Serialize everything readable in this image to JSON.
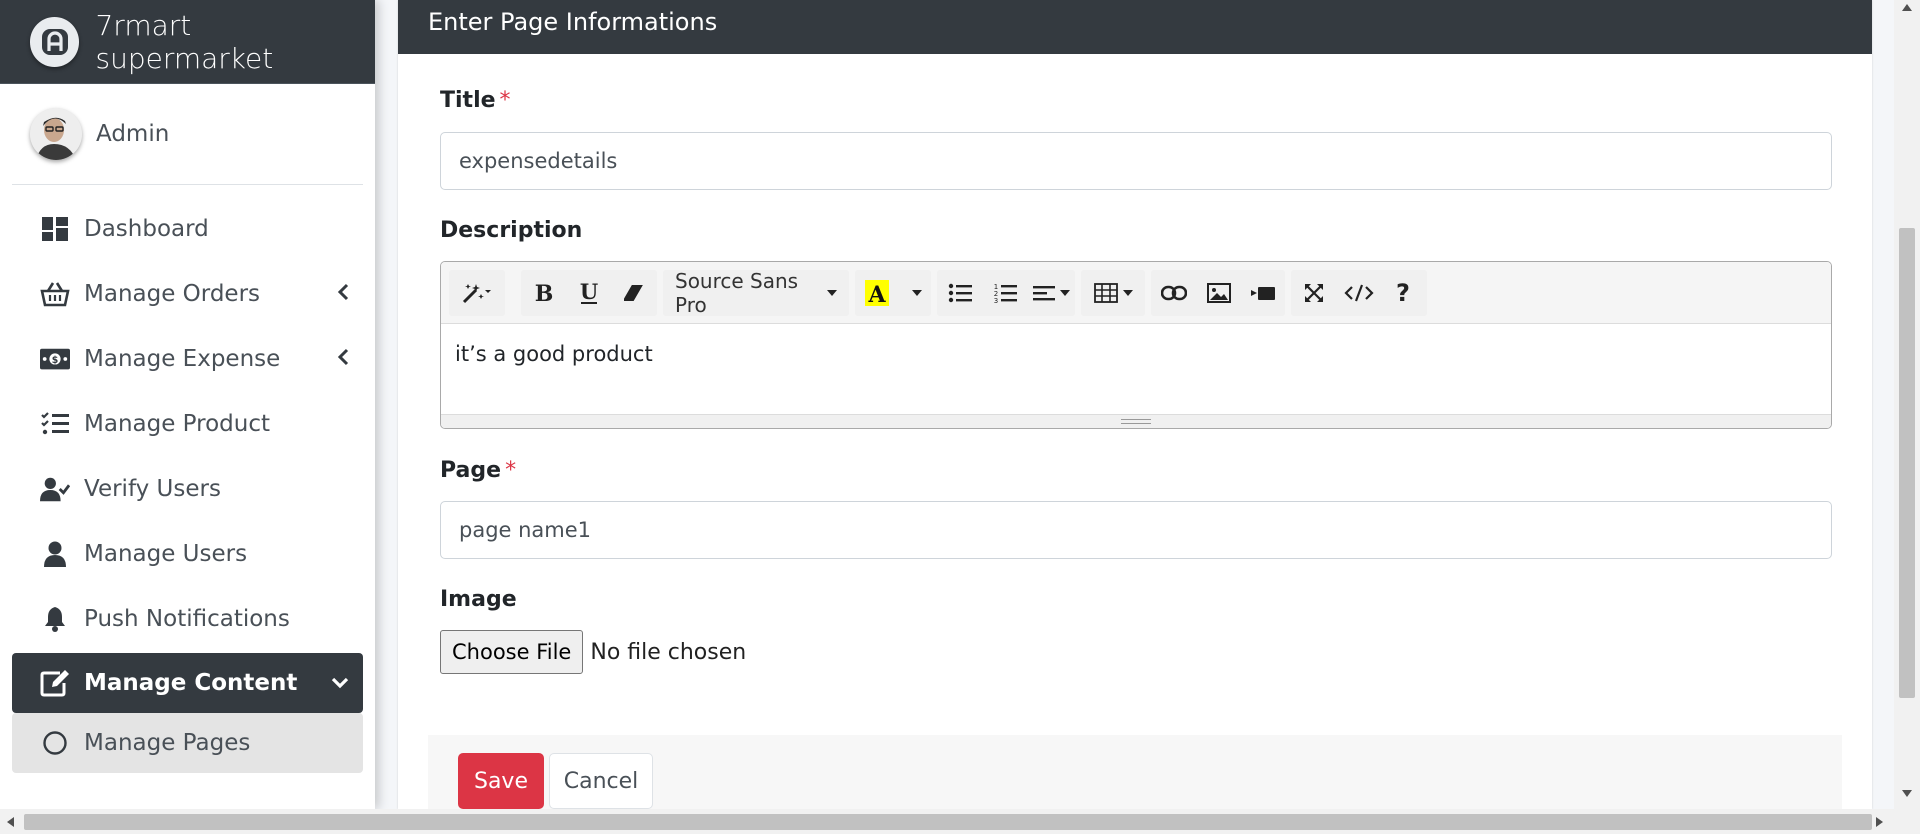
{
  "brand": {
    "name": "7rmart supermarket",
    "logo_icon": "brand-logo-icon"
  },
  "user": {
    "name": "Admin"
  },
  "sidebar": {
    "items": [
      {
        "label": "Dashboard",
        "icon": "dashboard-icon"
      },
      {
        "label": "Manage Orders",
        "icon": "basket-icon",
        "has_submenu": true
      },
      {
        "label": "Manage Expense",
        "icon": "money-bill-icon",
        "has_submenu": true
      },
      {
        "label": "Manage Product",
        "icon": "tasks-icon"
      },
      {
        "label": "Verify Users",
        "icon": "user-check-icon"
      },
      {
        "label": "Manage Users",
        "icon": "user-icon"
      },
      {
        "label": "Push Notifications",
        "icon": "bell-icon"
      },
      {
        "label": "Manage Content",
        "icon": "edit-icon",
        "active": true,
        "expanded": true
      },
      {
        "label": "Manage Pages",
        "icon": "circle-icon",
        "sub": true
      }
    ]
  },
  "card": {
    "header": "Enter Page Informations"
  },
  "form": {
    "title_label": "Title",
    "required_mark": "*",
    "title_value": "expensedetails",
    "description_label": "Description",
    "editor": {
      "font_name": "Source Sans Pro",
      "content": "it’s a good product",
      "highlight_color": "#ffff00"
    },
    "page_label": "Page",
    "page_value": "page name1",
    "image_label": "Image",
    "file_button": "Choose File",
    "file_status": "No file chosen"
  },
  "actions": {
    "save": "Save",
    "cancel": "Cancel",
    "save_color": "#dc3545"
  }
}
